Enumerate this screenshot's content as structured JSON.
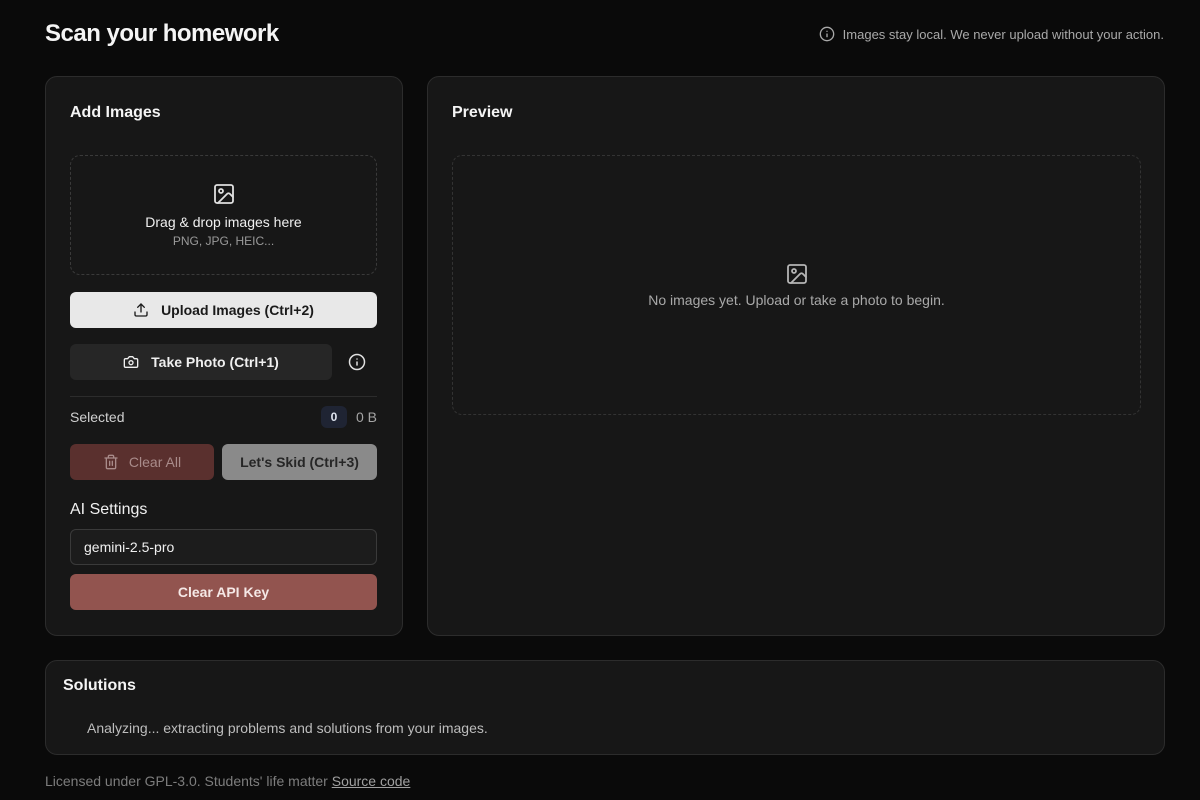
{
  "header": {
    "title": "Scan your homework",
    "privacy_note": "Images stay local. We never upload without your action.",
    "privacy_icon": "info-icon"
  },
  "add_images": {
    "title": "Add Images",
    "dropzone": {
      "icon": "image-icon",
      "main_text": "Drag & drop images here",
      "sub_text": "PNG, JPG, HEIC..."
    },
    "upload_button": {
      "label": "Upload Images (Ctrl+2)",
      "icon": "upload-icon"
    },
    "photo_button": {
      "label": "Take Photo (Ctrl+1)",
      "icon": "camera-icon"
    },
    "info_icon": "info-icon",
    "selected": {
      "label": "Selected",
      "count": "0",
      "size": "0 B"
    },
    "clear_all_button": {
      "label": "Clear All",
      "icon": "trash-icon"
    },
    "skid_button": {
      "label": "Let's Skid (Ctrl+3)"
    },
    "ai_settings": {
      "label": "AI Settings",
      "model_value": "gemini-2.5-pro",
      "clear_key_label": "Clear API Key"
    }
  },
  "preview": {
    "title": "Preview",
    "icon": "image-icon",
    "empty_message": "No images yet. Upload or take a photo to begin."
  },
  "solutions": {
    "title": "Solutions",
    "status": "Analyzing... extracting problems and solutions from your images."
  },
  "footer": {
    "license_text": "Licensed under GPL-3.0. Students' life matter",
    "source_link": "Source code"
  },
  "colors": {
    "background": "#0a0a0a",
    "card": "#171717",
    "danger": "#92544f",
    "danger_muted": "#5a302e"
  }
}
